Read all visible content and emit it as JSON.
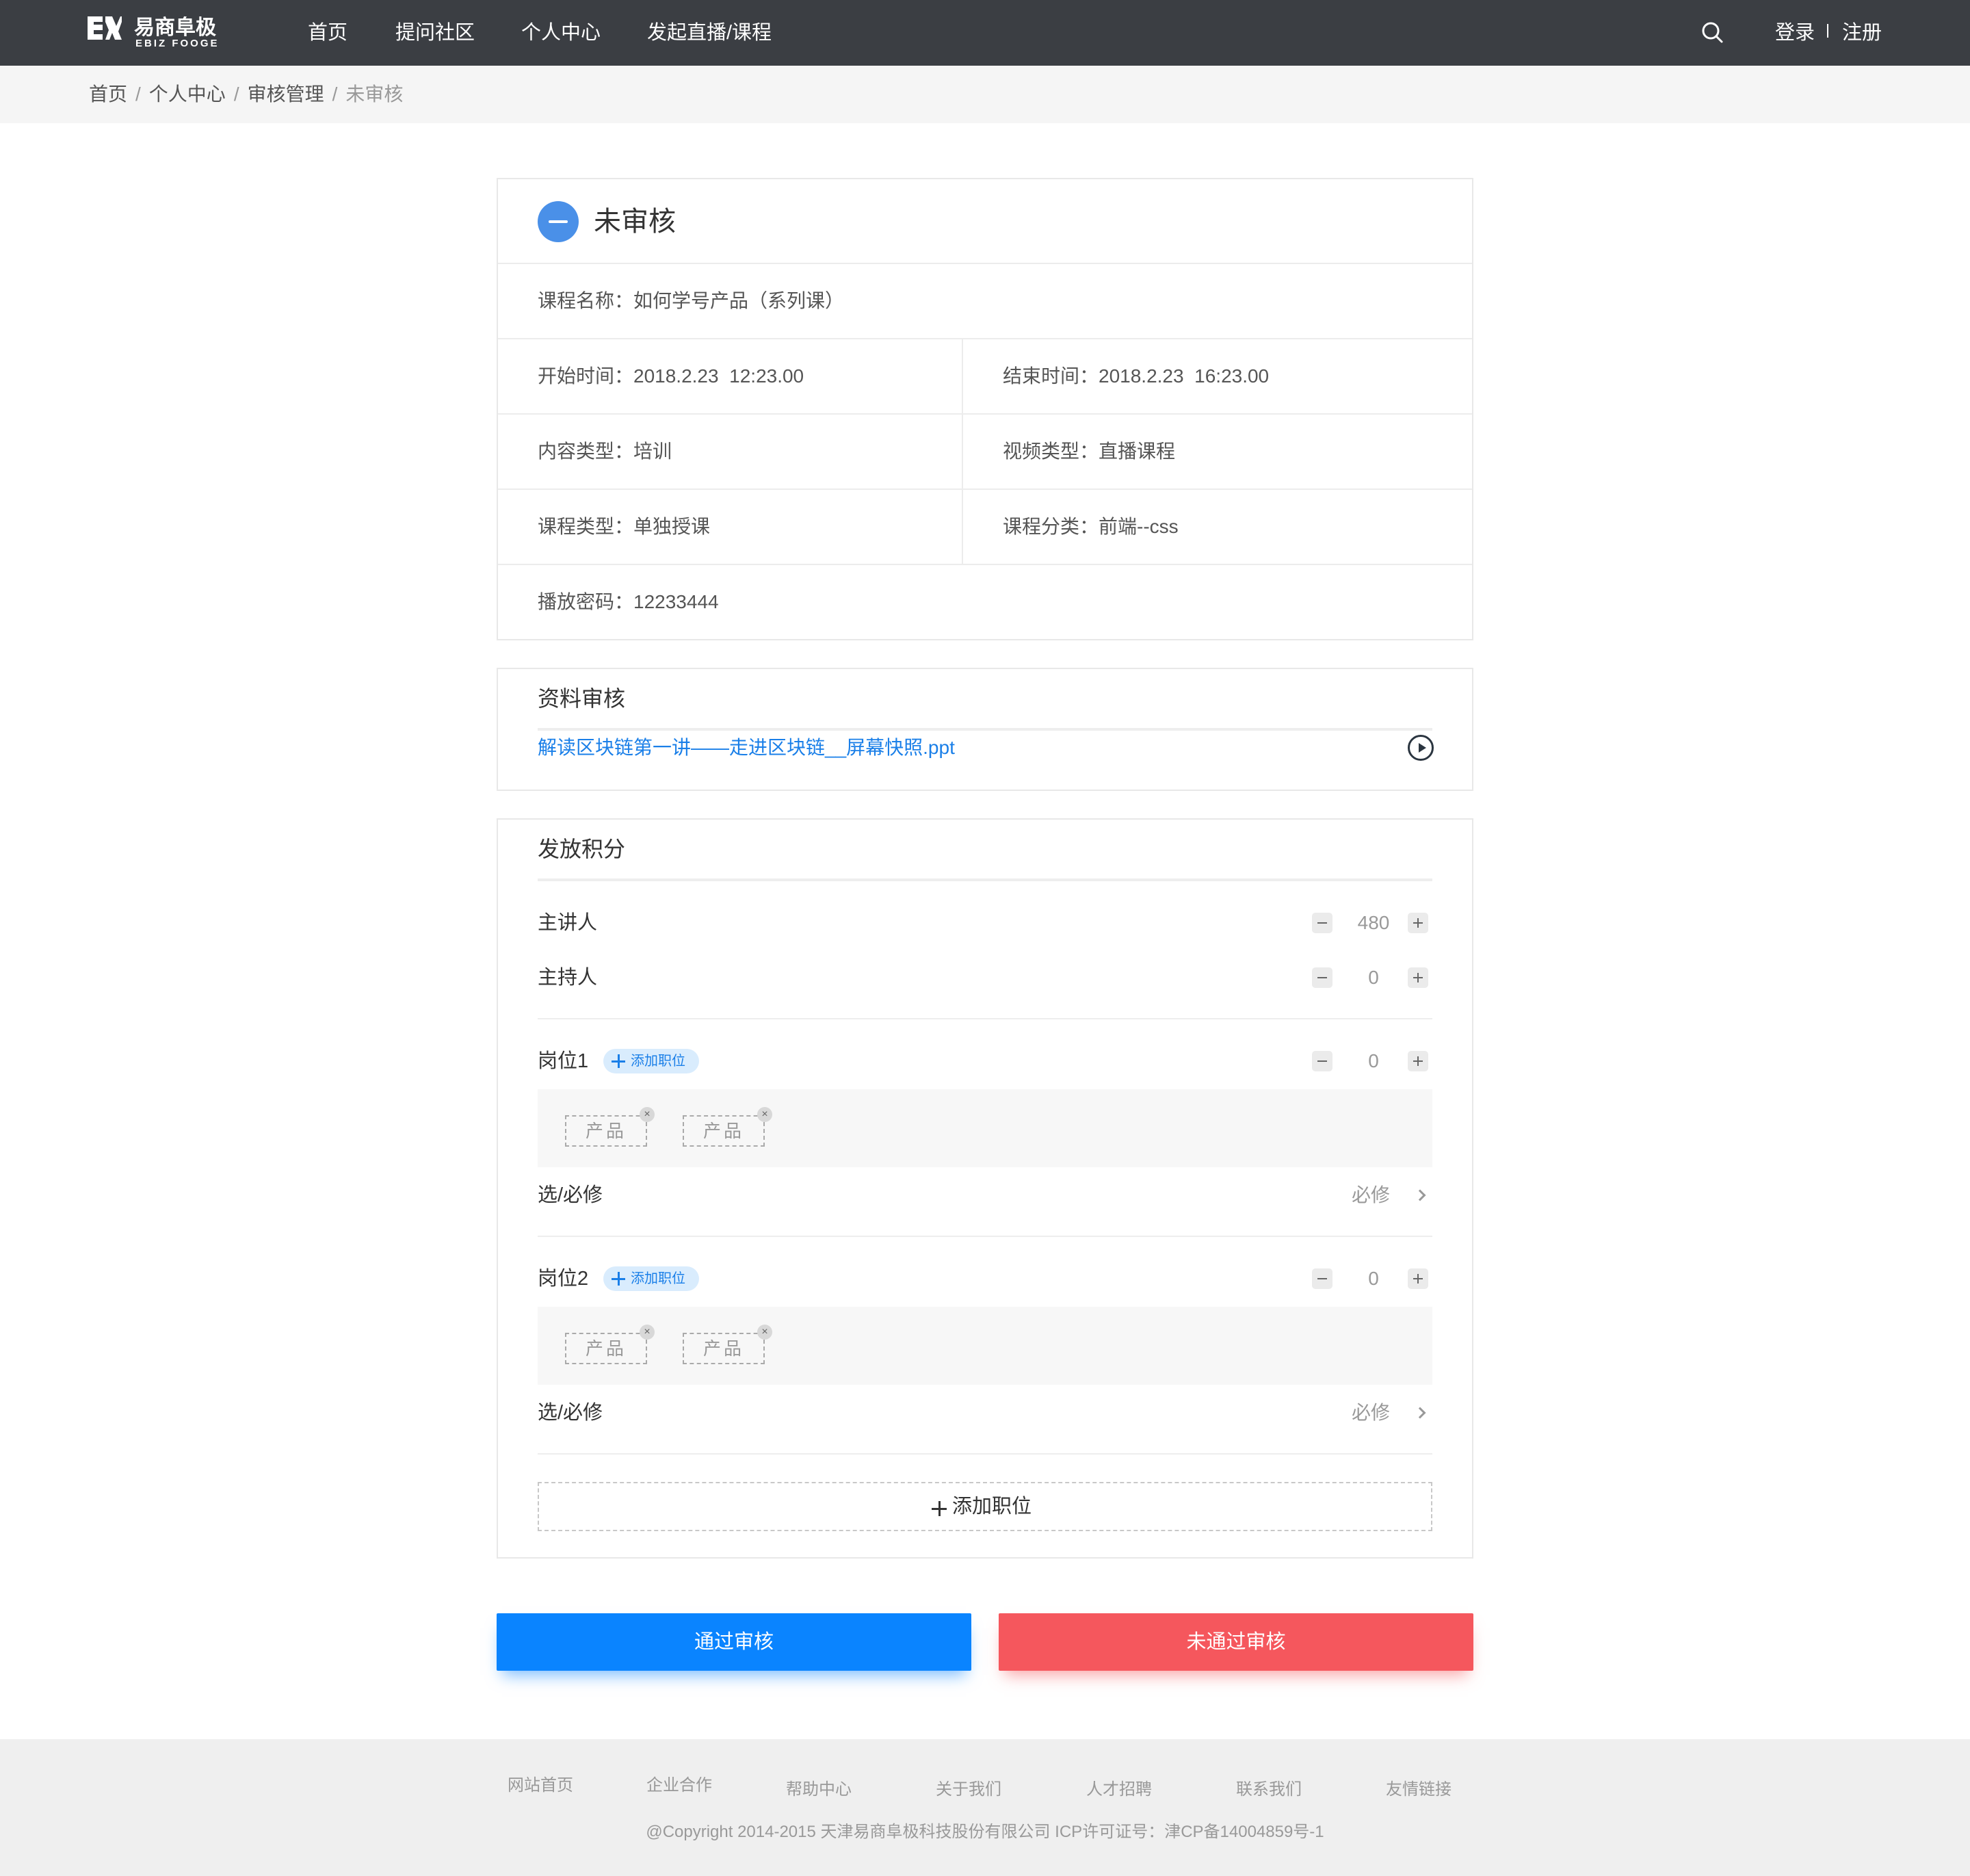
{
  "brand": {
    "name_cn": "易商阜极",
    "name_en": "EBIZ FOOGE"
  },
  "nav": {
    "items": [
      "首页",
      "提问社区",
      "个人中心",
      "发起直播/课程"
    ],
    "login": "登录",
    "register": "注册"
  },
  "breadcrumb": {
    "items": [
      "首页",
      "个人中心",
      "审核管理"
    ],
    "current": "未审核",
    "separator": "/"
  },
  "status": {
    "title": "未审核",
    "icon": "minus-circle-icon",
    "color": "#4a90e8"
  },
  "course_info": {
    "name_label": "课程名称：",
    "name_value": "如何学号产品（系列课）",
    "start_label": "开始时间：",
    "start_value": "2018.2.23  12:23.00",
    "end_label": "结束时间：",
    "end_value": "2018.2.23  16:23.00",
    "content_type_label": "内容类型：",
    "content_type_value": "培训",
    "video_type_label": "视频类型：",
    "video_type_value": "直播课程",
    "course_type_label": "课程类型：",
    "course_type_value": "单独授课",
    "category_label": "课程分类：",
    "category_value": "前端--css",
    "password_label": "播放密码：",
    "password_value": "12233444"
  },
  "material": {
    "title": "资料审核",
    "file_name": "解读区块链第一讲——走进区块链__屏幕快照.ppt",
    "icon": "play-circle-icon"
  },
  "points": {
    "title": "发放积分",
    "speaker": {
      "label": "主讲人",
      "value": "480"
    },
    "host": {
      "label": "主持人",
      "value": "0"
    },
    "positions": [
      {
        "label": "岗位1",
        "add_tag": "添加职位",
        "value": "0",
        "tags": [
          "产品",
          "产品"
        ],
        "required_label": "选/必修",
        "required_value": "必修"
      },
      {
        "label": "岗位2",
        "add_tag": "添加职位",
        "value": "0",
        "tags": [
          "产品",
          "产品"
        ],
        "required_label": "选/必修",
        "required_value": "必修"
      }
    ],
    "add_position": "添加职位"
  },
  "actions": {
    "approve": "通过审核",
    "reject": "未通过审核",
    "approve_color": "#0a84ff",
    "reject_color": "#f5575d"
  },
  "footer": {
    "links": [
      "网站首页",
      "企业合作",
      "帮助中心",
      "关于我们",
      "人才招聘",
      "联系我们",
      "友情链接"
    ],
    "copyright": "@Copyright 2014-2015 天津易商阜极科技股份有限公司 ICP许可证号：津CP备14004859号-1"
  }
}
